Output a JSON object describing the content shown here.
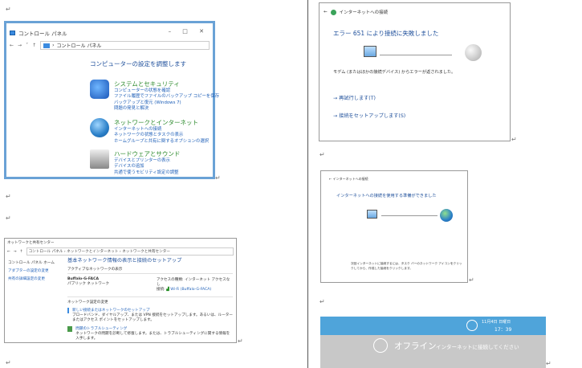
{
  "paragraph_mark": "↵",
  "control_panel": {
    "title": "コントロール パネル",
    "address": "コントロール パネル",
    "heading": "コンピューターの設定を調整します",
    "categories": [
      {
        "title": "システムとセキュリティ",
        "links": [
          "コンピューターの状態を確認",
          "ファイル履歴でファイルのバックアップ コピーを保存",
          "バックアップと復元 (Windows 7)",
          "問題の発見と解決"
        ]
      },
      {
        "title": "ネットワークとインターネット",
        "links": [
          "インターネットへの接続",
          "ネットワークの状態とタスクの表示",
          "ホームグループと共有に関するオプションの選択"
        ]
      },
      {
        "title": "ハードウェアとサウンド",
        "links": [
          "デバイスとプリンターの表示",
          "デバイスの追加",
          "共通で使うモビリティ設定の調整"
        ]
      }
    ]
  },
  "network_center": {
    "title": "ネットワークと共有センター",
    "address": "コントロール パネル › ネットワークとインターネット › ネットワークと共有センター",
    "side_links": [
      "コントロール パネル ホーム",
      "アダプターの設定の変更",
      "共有の詳細設定の変更"
    ],
    "heading": "基本ネットワーク情報の表示と接続のセットアップ",
    "active_label": "アクティブなネットワークの表示",
    "network_name": "Buffalo-G-FACA",
    "network_type": "パブリック ネットワーク",
    "access_type_label": "アクセスの種類:",
    "access_type_value": "インターネット アクセスなし",
    "connection_label": "接続:",
    "connection_value": "Wi-Fi (Buffalo-G-FACA)",
    "change_label": "ネットワーク設定の変更",
    "new_connection_title": "新しい接続またはネットワークのセットアップ",
    "new_connection_desc": "ブロードバンド、ダイヤルアップ、または VPN 接続をセットアップします。あるいは、ルーターまたはアクセス ポイントをセットアップします。",
    "troubleshoot_title": "問題のトラブルシューティング",
    "troubleshoot_desc": "ネットワークの問題を診断して修復します。または、トラブルシューティングに関する情報を入手します。"
  },
  "error_window": {
    "title": "インターネットへの接続",
    "heading": "エラー 651 により接続に失敗しました",
    "message": "モデム (またはほかの接続デバイス) からエラーが返されました。",
    "retry": "→ 再試行します(T)",
    "setup": "→ 接続をセットアップします(S)"
  },
  "ready_window": {
    "title": "インターネットへの接続",
    "heading": "インターネットへの接続を使用する準備ができました",
    "message": "次回インターネットに接続するには、タスク バーのネットワーク アイコンをクリックしてから、作成した接続をクリックします。"
  },
  "offline_bar": {
    "date": "11月4日 日曜日",
    "time": "17：39",
    "status": "オフライン",
    "message": "インターネットに接続してください"
  }
}
